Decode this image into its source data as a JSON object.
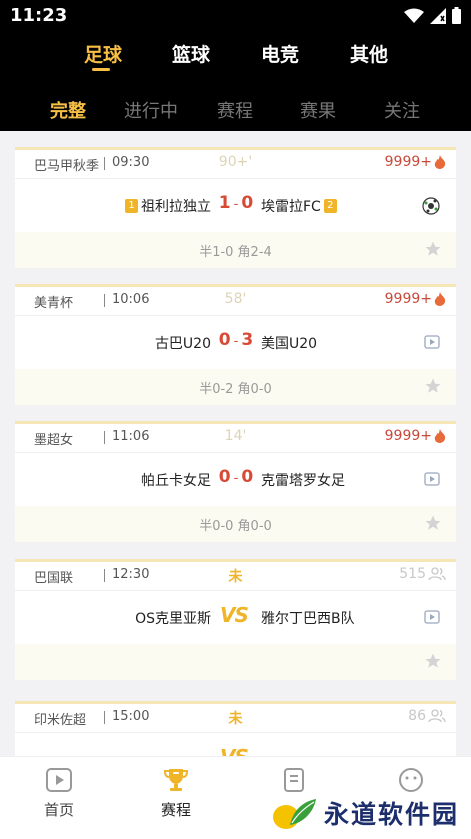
{
  "status_bar": {
    "time": "11:23"
  },
  "sport_tabs": [
    {
      "label": "足球",
      "active": true
    },
    {
      "label": "篮球",
      "active": false
    },
    {
      "label": "电竞",
      "active": false
    },
    {
      "label": "其他",
      "active": false
    }
  ],
  "sub_tabs": [
    {
      "label": "完整",
      "active": true
    },
    {
      "label": "进行中",
      "active": false
    },
    {
      "label": "赛程",
      "active": false
    },
    {
      "label": "赛果",
      "active": false
    },
    {
      "label": "关注",
      "active": false
    }
  ],
  "matches": [
    {
      "league": "巴马甲秋季",
      "time": "09:30",
      "minute": "90+'",
      "heat": "9999+",
      "home": "祖利拉独立",
      "home_rank": "1",
      "home_score": "1",
      "away_score": "0",
      "separator": "-",
      "away": "埃雷拉FC",
      "away_rank": "2",
      "detail": "半1-0 角2-4"
    },
    {
      "league": "美青杯",
      "time": "10:06",
      "minute": "58'",
      "heat": "9999+",
      "home": "古巴U20",
      "home_score": "0",
      "away_score": "3",
      "separator": "-",
      "away": "美国U20",
      "detail": "半0-2 角0-0"
    },
    {
      "league": "墨超女",
      "time": "11:06",
      "minute": "14'",
      "heat": "9999+",
      "home": "帕丘卡女足",
      "home_score": "0",
      "away_score": "0",
      "separator": "-",
      "away": "克雷塔罗女足",
      "detail": "半0-0 角0-0"
    },
    {
      "league": "巴国联",
      "time": "12:30",
      "minute": "未",
      "people": "515",
      "home": "OS克里亚斯",
      "vs": "VS",
      "away": "雅尔丁巴西B队",
      "detail": ""
    },
    {
      "league": "印米佐超",
      "time": "15:00",
      "minute": "未",
      "people": "86"
    }
  ],
  "bottom_nav": [
    {
      "label": "首页",
      "icon": "play-icon"
    },
    {
      "label": "赛程",
      "icon": "trophy-icon",
      "active": true
    },
    {
      "label": "",
      "icon": "news-icon"
    },
    {
      "label": "",
      "icon": "smile-icon"
    }
  ],
  "watermark": {
    "text": "永道软件园"
  },
  "colors": {
    "accent": "#f7bf45",
    "score": "#d84a36",
    "header_bg": "#000000"
  }
}
